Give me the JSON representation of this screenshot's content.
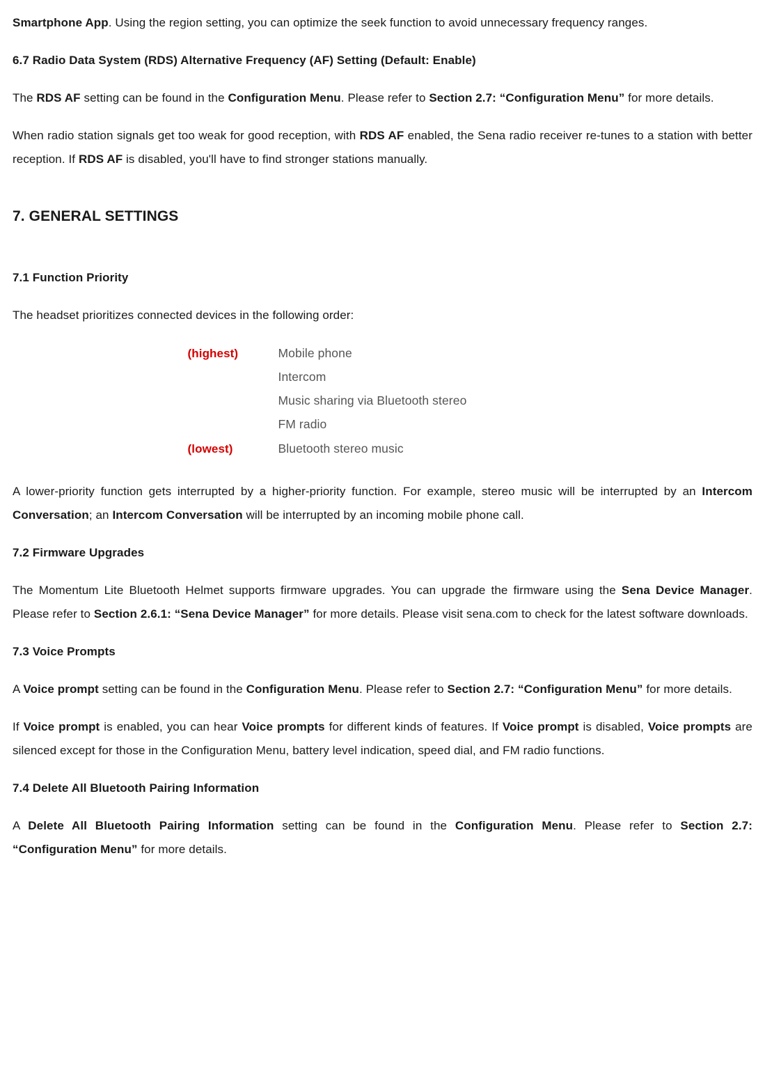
{
  "intro": {
    "p1_a": "Smartphone App",
    "p1_b": ". Using the region setting, you can optimize the seek function to avoid unnecessary frequency ranges."
  },
  "s6_7": {
    "heading": "6.7 Radio Data System (RDS) Alternative Frequency (AF) Setting (Default: Enable)",
    "p1_a": "The ",
    "p1_b": "RDS AF",
    "p1_c": " setting can be found in the ",
    "p1_d": "Configuration Menu",
    "p1_e": ". Please refer to ",
    "p1_f": "Section 2.7: “Configuration Menu”",
    "p1_g": " for more details.",
    "p2_a": "When radio station signals get too weak for good reception, with ",
    "p2_b": "RDS AF",
    "p2_c": " enabled, the Sena radio receiver re-tunes to a station with better reception. If ",
    "p2_d": "RDS AF",
    "p2_e": " is disabled, you'll have to find stronger stations manually."
  },
  "s7": {
    "heading": "7. GENERAL SETTINGS"
  },
  "s7_1": {
    "heading": "7.1 Function Priority",
    "p1": "The headset prioritizes connected devices in the following order:",
    "labelHigh": "(highest)",
    "labelLow": "(lowest)",
    "items": {
      "i0": "Mobile phone",
      "i1": "Intercom",
      "i2": "Music sharing via Bluetooth stereo",
      "i3": "FM radio",
      "i4": "Bluetooth stereo music"
    },
    "p2_a": "A lower-priority function gets interrupted by a higher-priority function. For example, stereo music will be interrupted by an ",
    "p2_b": "Intercom Conversation",
    "p2_c": "; an ",
    "p2_d": "Intercom Conversation",
    "p2_e": " will be interrupted by an incoming mobile phone call."
  },
  "s7_2": {
    "heading": "7.2 Firmware Upgrades",
    "p1_a": "The Momentum Lite Bluetooth Helmet supports firmware upgrades. You can upgrade the firmware using the ",
    "p1_b": "Sena Device Manager",
    "p1_c": ". Please refer to ",
    "p1_d": "Section 2.6.1: “Sena Device Manager”",
    "p1_e": " for more details. Please visit sena.com to check for the latest software downloads."
  },
  "s7_3": {
    "heading": "7.3 Voice Prompts",
    "p1_a": "A ",
    "p1_b": "Voice prompt",
    "p1_c": " setting can be found in the ",
    "p1_d": "Configuration Menu",
    "p1_e": ". Please refer to ",
    "p1_f": "Section 2.7: “Configuration Menu”",
    "p1_g": " for more details.",
    "p2_a": "If ",
    "p2_b": "Voice prompt",
    "p2_c": " is enabled, you can hear ",
    "p2_d": "Voice prompts",
    "p2_e": " for different kinds of features. If ",
    "p2_f": "Voice prompt",
    "p2_g": " is disabled, ",
    "p2_h": "Voice prompts",
    "p2_i": " are silenced except for those in the Configuration Menu, battery level indication, speed dial, and FM radio functions."
  },
  "s7_4": {
    "heading": "7.4 Delete All Bluetooth Pairing Information",
    "p1_a": "A ",
    "p1_b": "Delete All Bluetooth Pairing Information",
    "p1_c": " setting can be found in the ",
    "p1_d": "Configuration Menu",
    "p1_e": ". Please refer to ",
    "p1_f": "Section 2.7: “Configuration Menu”",
    "p1_g": " for more details."
  }
}
